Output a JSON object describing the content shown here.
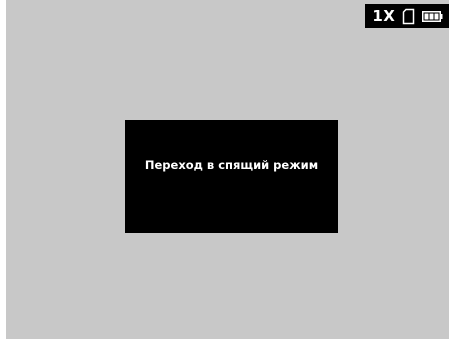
{
  "status_bar": {
    "zoom": "1X",
    "sd_card_icon": "sd-card-icon",
    "battery_icon": "battery-full-icon"
  },
  "dialog": {
    "message": "Переход в спящий режим"
  },
  "colors": {
    "screen_background": "#c8c8c8",
    "overlay_background": "#000000",
    "text": "#ffffff"
  }
}
